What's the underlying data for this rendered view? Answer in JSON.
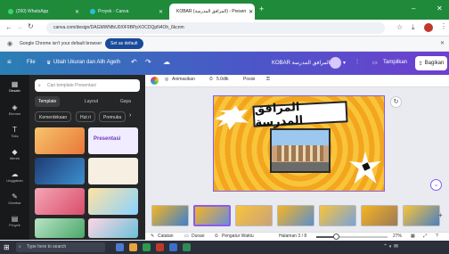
{
  "browser": {
    "tabs": [
      {
        "label": "(260) WhatsApp"
      },
      {
        "label": "Proyek - Canva"
      },
      {
        "label": "KOBAR (المرافق المدرسة) - Presen"
      }
    ],
    "new_tab": "+",
    "url": "canva.com/design/DAGMWNfbU0/0F9BPpXOCDQpN4Oh_6kcnm",
    "minimize": "–",
    "close": "✕"
  },
  "infobar": {
    "message": "Google Chrome isn't your default browser",
    "button": "Set as default"
  },
  "canva_bar": {
    "file": "File",
    "resize": "Ubah Ukuran dan Alih Agelh",
    "doc_title": "KOBAR المرافق المدرسة",
    "present": "Tampilkan",
    "share": "Bagikan"
  },
  "rail": [
    {
      "label": "Desain"
    },
    {
      "label": "Elemen"
    },
    {
      "label": "Teks"
    },
    {
      "label": "Merek"
    },
    {
      "label": "Unggahan"
    },
    {
      "label": "Gambar"
    },
    {
      "label": "Proyek"
    }
  ],
  "panel": {
    "search_placeholder": "Cari template Presentasi",
    "tabs": [
      "Template",
      "Layout",
      "Gaya"
    ],
    "chips": [
      "Kemerdekaan",
      "Hut ri",
      "Premuka"
    ],
    "template_texts": [
      "Presentasi"
    ]
  },
  "toolbar": {
    "animate": "Animasikan",
    "duration": "5.0dtk",
    "position": "Posisi"
  },
  "slide": {
    "title": "المرافق المدرسة"
  },
  "footer": {
    "notes": "Catatan",
    "duration": "Durasi",
    "timer": "Pengatur Waktu",
    "page": "Halaman 3 / 8",
    "zoom": "27%",
    "zoom_fraction": 0.27
  },
  "taskbar": {
    "search": "Type here to search"
  },
  "colors": {
    "chrome_green": "#1f8a3a",
    "canva_start": "#2a7fb4",
    "canva_end": "#6e3fd0",
    "accent": "#8a5cf0"
  }
}
